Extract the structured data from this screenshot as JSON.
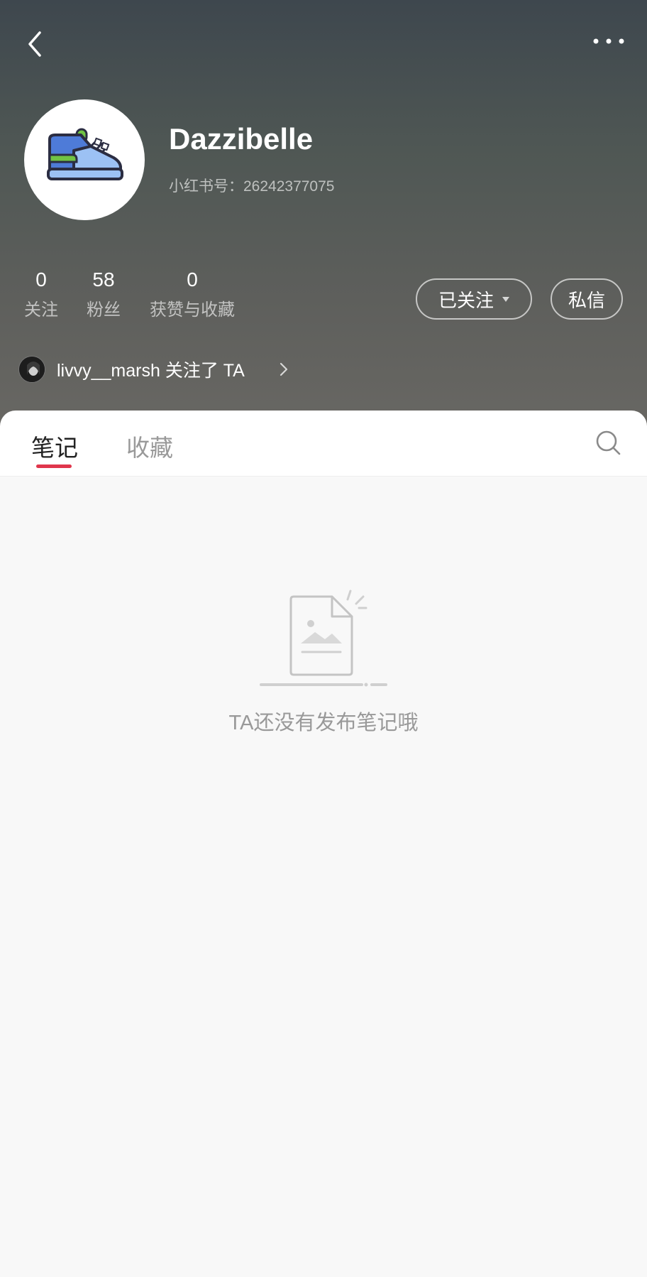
{
  "profile": {
    "username": "Dazzibelle",
    "id_label": "小红书号：",
    "id_value": "26242377075",
    "avatar_icon": "sneaker-icon"
  },
  "stats": [
    {
      "value": "0",
      "label": "关注"
    },
    {
      "value": "58",
      "label": "粉丝"
    },
    {
      "value": "0",
      "label": "获赞与收藏"
    }
  ],
  "actions": {
    "follow_label": "已关注",
    "message_label": "私信"
  },
  "followed_by": {
    "username": "livvy__marsh",
    "text": " 关注了 TA"
  },
  "tabs": [
    {
      "label": "笔记",
      "active": true
    },
    {
      "label": "收藏",
      "active": false
    }
  ],
  "empty_state": {
    "message": "TA还没有发布笔记哦"
  },
  "colors": {
    "accent": "#e0364c",
    "header_top": "#3e474e",
    "header_bottom": "#686763"
  }
}
